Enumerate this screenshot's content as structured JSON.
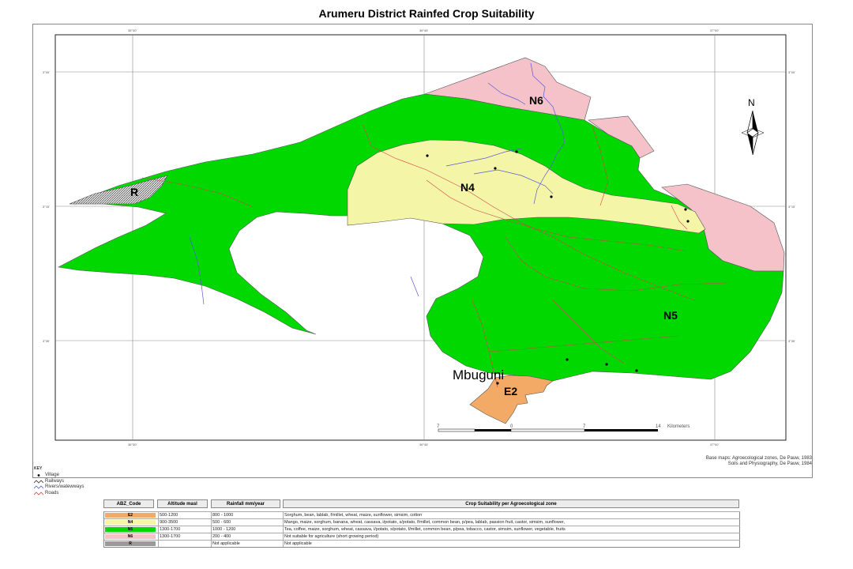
{
  "title": "Arumeru District Rainfed Crop Suitability",
  "map": {
    "north_label": "N",
    "scale_ticks": [
      "7",
      "0",
      "7",
      "14"
    ],
    "scale_unit": "Kilometers",
    "place_label": "Mbuguni",
    "zone_labels": {
      "N6": "N6",
      "N4": "N4",
      "N5": "N5",
      "E2": "E2",
      "R": "R"
    },
    "colors": {
      "N6": "#f4c2c8",
      "N4": "#f5f5a8",
      "N5": "#00d800",
      "E2": "#f2aa66",
      "R": "hatched-grey"
    }
  },
  "credits": {
    "line1": "Base maps: Agroecological zones, De Pauw, 1983",
    "line2": "Soils and Physiography, De Pauw, 1984"
  },
  "key": {
    "title": "KEY",
    "items": [
      {
        "symbol": "dot",
        "label": "Village"
      },
      {
        "symbol": "rail",
        "label": "Railways"
      },
      {
        "symbol": "river",
        "label": "Rivers/watewways"
      },
      {
        "symbol": "road",
        "label": "Roads"
      }
    ]
  },
  "legend_table": {
    "headers": [
      "ABZ_Code",
      "Altitude masl",
      "Rainfall mm/year",
      "Crop Suitability per Agroecological zone"
    ],
    "rows": [
      {
        "code": "E2",
        "color": "#f2aa66",
        "altitude": "500-1200",
        "rainfall": "800 - 1000",
        "crops": "Sorghum, bean, lablab, f/millet, wheat, maize, sunflower, simsim, cotton"
      },
      {
        "code": "N4",
        "color": "#f5f5a8",
        "altitude": "900-3500",
        "rainfall": "500 - 600",
        "crops": "Mango, maize, sorghum, banana, wheat, cassava, i/potato, s/potato, f/millet, common bean, p/pea, lablab, passion fruit, castor, simsim, sunflower,"
      },
      {
        "code": "N5",
        "color": "#00d800",
        "altitude": "1300-1700",
        "rainfall": "1000 - 1200",
        "crops": "Tea, coffee, maize, sorghum, wheat, cassava, i/potato, s/potato, f/millet, common bean, p/pea, tobacco, castor, simsim, sunflower, vegetable, fruits"
      },
      {
        "code": "N6",
        "color": "#f4c2c8",
        "altitude": "1300-1700",
        "rainfall": "200 - 400",
        "crops": "Not suitable for agriculture (short growing period)"
      },
      {
        "code": "R",
        "color": "#9a9a9a",
        "altitude": "",
        "rainfall": "Not applicable",
        "crops": "Not applicable"
      }
    ]
  }
}
